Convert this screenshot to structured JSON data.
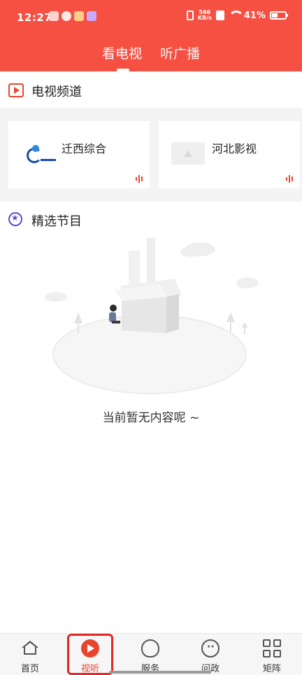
{
  "status_bar": {
    "time": "12:27",
    "net_speed_value": "566",
    "net_speed_unit": "KB/s",
    "battery": "41%"
  },
  "top_tabs": {
    "tv": "看电视",
    "radio": "听广播",
    "active": "看电视"
  },
  "tv_section": {
    "title": "电视频道",
    "channels": [
      {
        "name": "迁西综合",
        "logo": "qianxi-logo"
      },
      {
        "name": "河北影视",
        "logo": "image-placeholder"
      }
    ]
  },
  "selected_section": {
    "title": "精选节目",
    "empty_text": "当前暂无内容呢 ~"
  },
  "bottom_nav": {
    "items": [
      {
        "label": "首页",
        "icon": "home-icon"
      },
      {
        "label": "视听",
        "icon": "play-icon",
        "active": true
      },
      {
        "label": "服务",
        "icon": "heart-icon"
      },
      {
        "label": "问政",
        "icon": "chat-icon"
      },
      {
        "label": "矩阵",
        "icon": "grid-icon"
      }
    ]
  },
  "colors": {
    "brand_red": "#f65043",
    "accent": "#e8452f",
    "highlight_border": "#e42626"
  }
}
